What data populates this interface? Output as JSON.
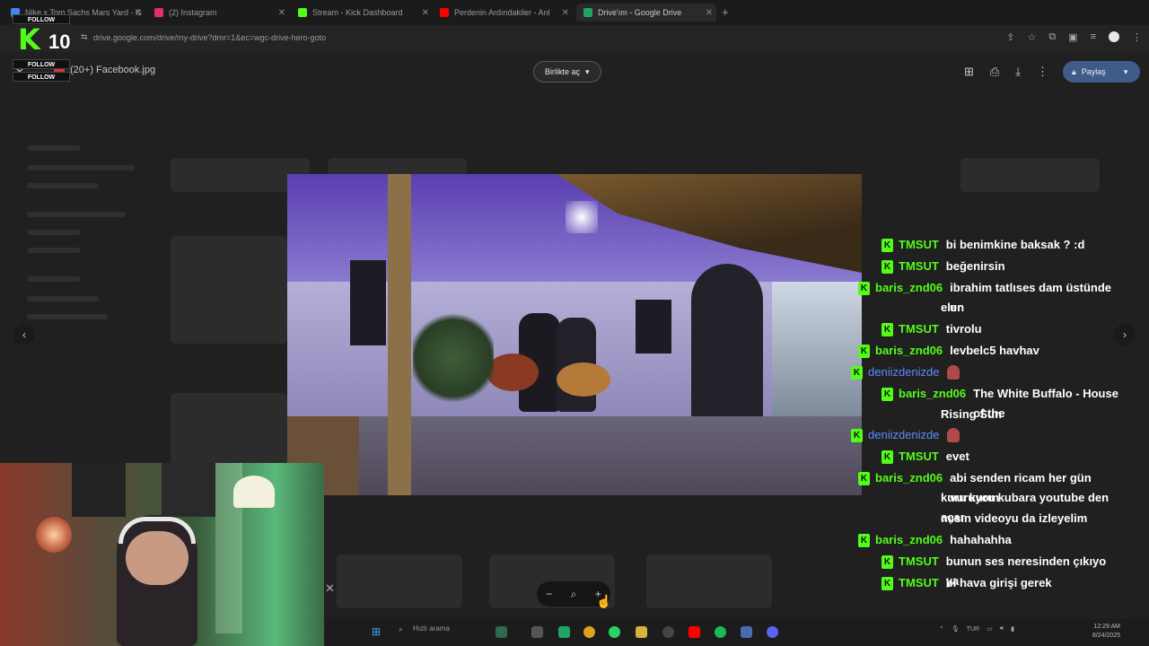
{
  "browser": {
    "tabs": [
      {
        "label": "Nike x Tom Sachs Mars Yard - G",
        "favicon": "google-icon",
        "color": "#4285f4"
      },
      {
        "label": "(2) Instagram",
        "favicon": "instagram-icon",
        "color": "#e1306c"
      },
      {
        "label": "Stream - Kick Dashboard",
        "favicon": "kick-icon",
        "color": "#53fc18"
      },
      {
        "label": "Perdenin Ardındakiler - Anl",
        "favicon": "youtube-icon",
        "color": "#ff0000"
      },
      {
        "label": "Drive'ım - Google Drive",
        "favicon": "drive-icon",
        "color": "#1fa463"
      }
    ],
    "new_tab": "+",
    "url": "drive.google.com/drive/my-drive?dmr=1&ec=wgc-drive-hero-goto"
  },
  "viewer": {
    "file_name": "(20+) Facebook.jpg",
    "open_with_label": "Birlikte aç",
    "share_label": "Paylaş",
    "prev_arrow": "‹",
    "next_arrow": "›"
  },
  "zoom": {
    "minus": "−",
    "search": "⌕",
    "plus": "+"
  },
  "kick_overlay": {
    "follow_label": "FOLLOW",
    "logo_letter": "K",
    "count": "10"
  },
  "chat": [
    {
      "user": "TMSUT",
      "text": "bi benimkine baksak ? :d",
      "color": "#53fc18",
      "badge": true
    },
    {
      "user": "TMSUT",
      "text": "beğenirsin",
      "color": "#53fc18",
      "badge": true
    },
    {
      "user": "baris_znd06",
      "text": "ibrahim tatlıses dam üstünde un",
      "text2": "eler",
      "color": "#53fc18",
      "badge": true
    },
    {
      "user": "TMSUT",
      "text": "tivrolu",
      "color": "#53fc18",
      "badge": true
    },
    {
      "user": "baris_znd06",
      "text": "levbelc5 havhav",
      "color": "#53fc18",
      "badge": true
    },
    {
      "user": "deniizdenizde",
      "text": "",
      "color": "#5b8cff",
      "badge": true,
      "emote": true
    },
    {
      "user": "baris_znd06",
      "text": "The White Buffalo - House of the",
      "text2": "Rising Sun",
      "color": "#53fc18",
      "badge": true
    },
    {
      "user": "deniizdenizde",
      "text": "",
      "color": "#5b8cff",
      "badge": true,
      "emote": true
    },
    {
      "user": "TMSUT",
      "text": "evet",
      "color": "#53fc18",
      "badge": true
    },
    {
      "user": "baris_znd06",
      "text": "abi senden ricam her gün vuruyom",
      "text2": "kuru kuru kubara youtube den açar",
      "text3": "mısın videoyu da izleyelim",
      "color": "#53fc18",
      "badge": true
    },
    {
      "user": "baris_znd06",
      "text": "hahahahha",
      "color": "#53fc18",
      "badge": true
    },
    {
      "user": "TMSUT",
      "text": "bunun ses neresinden çıkıyo ya",
      "color": "#53fc18",
      "badge": true
    },
    {
      "user": "TMSUT",
      "text": "bi hava girişi gerek",
      "color": "#53fc18",
      "badge": true
    }
  ],
  "taskbar": {
    "search_placeholder": "Hızlı arama",
    "lang": "TUR",
    "time": "12:29 AM",
    "date": "8/24/2025"
  },
  "colors": {
    "kick_green": "#53fc18",
    "share_blue": "#3f5b88"
  }
}
